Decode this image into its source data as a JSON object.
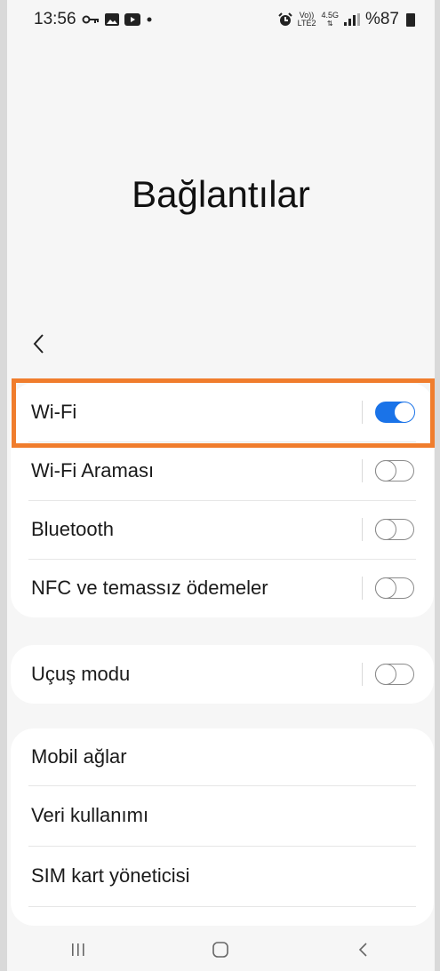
{
  "status_bar": {
    "time": "13:56",
    "left_icons": [
      "key-icon",
      "image-icon",
      "youtube-icon",
      "dot-icon"
    ],
    "right_icons": [
      "alarm-icon",
      "volte-icon",
      "4.5g-icon",
      "signal-icon",
      "battery-icon"
    ],
    "volte_label_top": "Vo))",
    "volte_label_bottom": "LTE2",
    "network_label": "4.5G",
    "battery_percent": "%87"
  },
  "page": {
    "title": "Bağlantılar"
  },
  "groups": [
    {
      "items": [
        {
          "label": "Wi-Fi",
          "toggle": true,
          "enabled": true
        },
        {
          "label": "Wi-Fi Araması",
          "toggle": true,
          "enabled": false
        },
        {
          "label": "Bluetooth",
          "toggle": true,
          "enabled": false
        },
        {
          "label": "NFC ve temassız ödemeler",
          "toggle": true,
          "enabled": false
        }
      ]
    },
    {
      "items": [
        {
          "label": "Uçuş modu",
          "toggle": true,
          "enabled": false
        }
      ]
    },
    {
      "items": [
        {
          "label": "Mobil ağlar"
        },
        {
          "label": "Veri kullanımı"
        },
        {
          "label": "SIM kart yöneticisi"
        }
      ]
    }
  ],
  "highlight_color": "#f07d2d",
  "accent_color": "#1a73e8",
  "nav_bar": [
    "recent-apps-icon",
    "home-icon",
    "back-icon"
  ]
}
